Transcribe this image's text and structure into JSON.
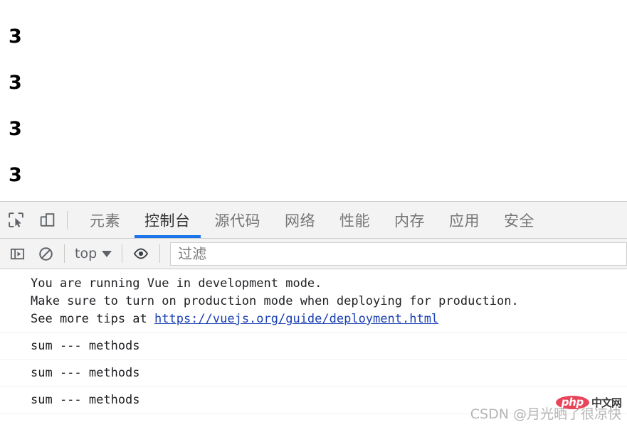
{
  "page": {
    "output_lines": [
      "3",
      "3",
      "3",
      "3"
    ]
  },
  "devtools": {
    "inspect_icon": "inspect-element-icon",
    "device_icon": "device-toolbar-icon",
    "tabs": [
      {
        "label": "元素",
        "active": false
      },
      {
        "label": "控制台",
        "active": true
      },
      {
        "label": "源代码",
        "active": false
      },
      {
        "label": "网络",
        "active": false
      },
      {
        "label": "性能",
        "active": false
      },
      {
        "label": "内存",
        "active": false
      },
      {
        "label": "应用",
        "active": false
      },
      {
        "label": "安全",
        "active": false
      }
    ],
    "active_tab_accent": "#1a73e8",
    "console_toolbar": {
      "sidebar_icon": "console-sidebar-icon",
      "clear_icon": "clear-console-icon",
      "context": "top",
      "eye_icon": "live-expression-eye-icon",
      "filter_placeholder": "过滤",
      "filter_value": ""
    },
    "messages": [
      {
        "lines": [
          "You are running Vue in development mode.",
          "Make sure to turn on production mode when deploying for production.",
          "See more tips at "
        ],
        "link": "https://vuejs.org/guide/deployment.html"
      },
      {
        "lines": [
          "sum --- methods"
        ],
        "link": ""
      },
      {
        "lines": [
          "sum --- methods"
        ],
        "link": ""
      },
      {
        "lines": [
          "sum --- methods"
        ],
        "link": ""
      }
    ]
  },
  "watermark": {
    "text": "CSDN @月光晒了很凉快",
    "logo_text": "php",
    "logo_suffix": "中文网",
    "logo_color": "#e8455a"
  }
}
